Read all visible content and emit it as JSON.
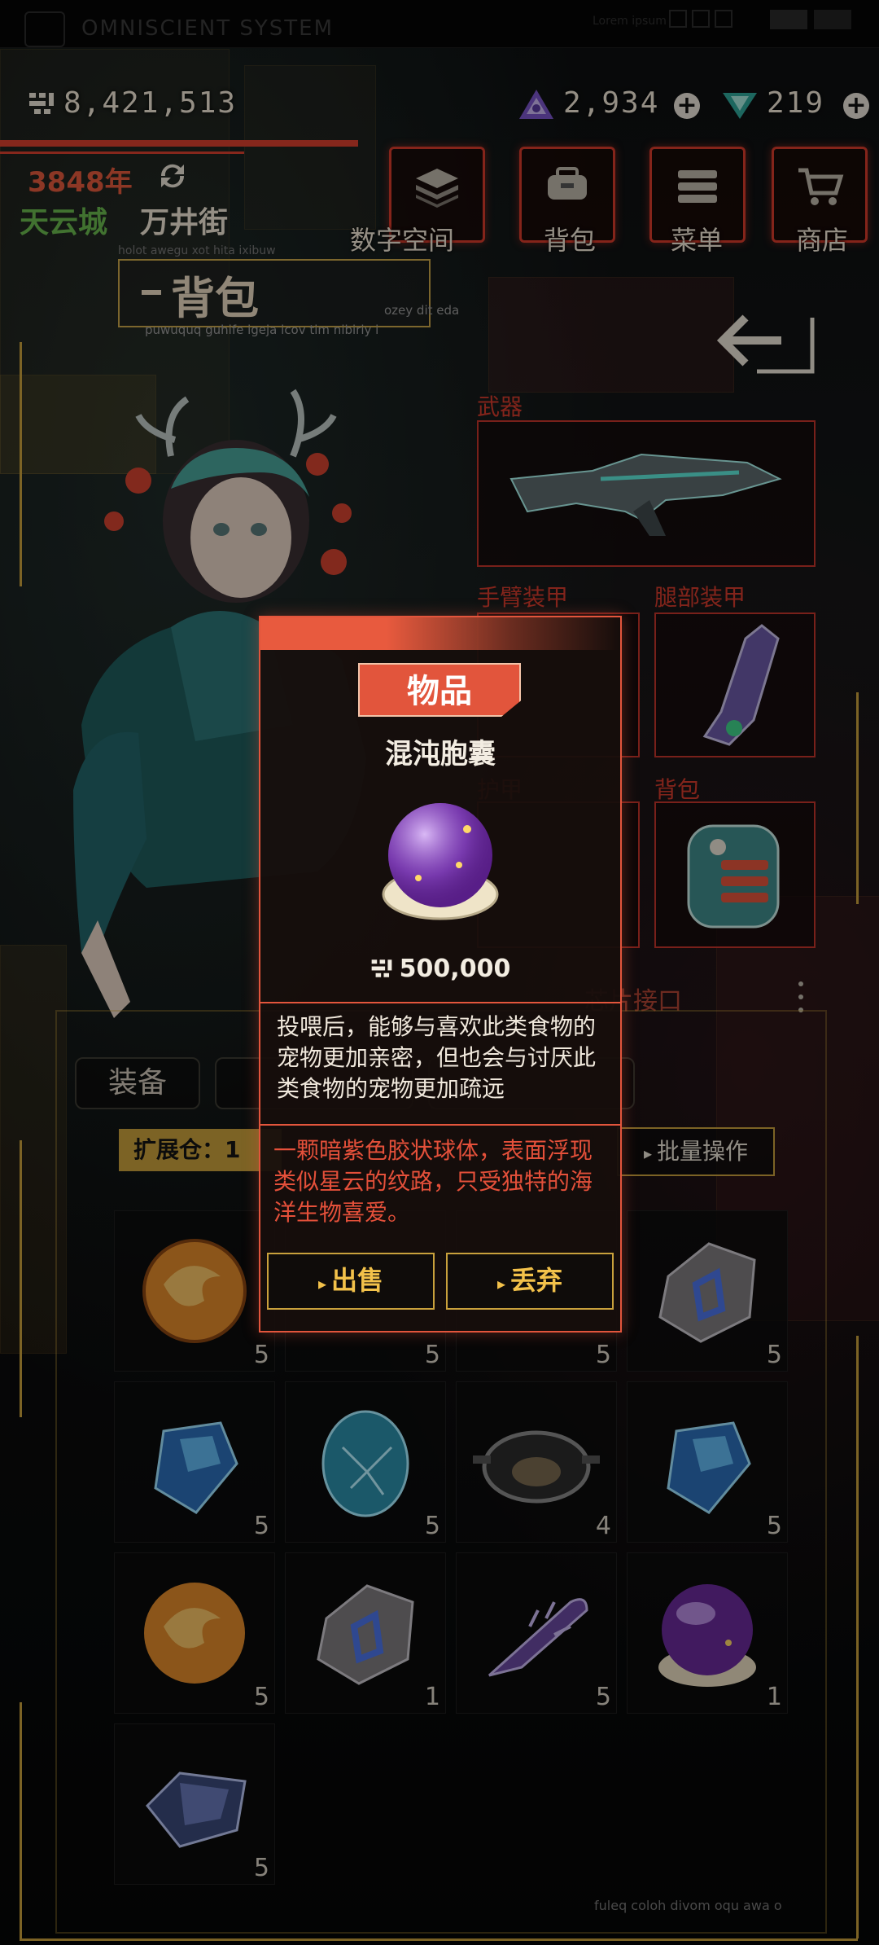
{
  "system": {
    "title": "OMNISCIENT SYSTEM",
    "lorem": "Lorem ipsum"
  },
  "currency": {
    "money": "8,421,513",
    "gems": "2,934",
    "crystals": "219"
  },
  "location": {
    "year": "3848年",
    "city": "天云城",
    "street": "万井街"
  },
  "nav": [
    {
      "label": "数字空间",
      "icon": "layers-icon"
    },
    {
      "label": "背包",
      "icon": "bag-icon"
    },
    {
      "label": "菜单",
      "icon": "menu-icon"
    },
    {
      "label": "商店",
      "icon": "cart-icon"
    }
  ],
  "backpack": {
    "title": "背包",
    "sub1": "holot awegu xot hita ixibuw",
    "sub2": "puwuquq guhife igeja icov tim nibiriy i",
    "sub3": "ozey dit eda"
  },
  "equipment": {
    "weapon_label": "武器",
    "arm_label": "手臂装甲",
    "leg_label": "腿部装甲",
    "chest_label": "护甲",
    "bag_label": "背包",
    "chip_label": "芯片接口"
  },
  "inventory": {
    "tab_equip": "装备",
    "capacity_label": "扩展仓：1",
    "batch_label": "批量操作",
    "items": [
      {
        "icon": "fire-orb-icon",
        "qty": "5"
      },
      {
        "icon": "crystal-egg-icon",
        "qty": "5"
      },
      {
        "icon": "item-icon",
        "qty": "5"
      },
      {
        "icon": "rune-stone-icon",
        "qty": "5"
      },
      {
        "icon": "blue-gem-icon",
        "qty": "5"
      },
      {
        "icon": "crystal-egg-icon",
        "qty": "5"
      },
      {
        "icon": "pan-icon",
        "qty": "4"
      },
      {
        "icon": "blue-gem-icon",
        "qty": "5"
      },
      {
        "icon": "fire-orb-icon",
        "qty": "5"
      },
      {
        "icon": "rune-stone-icon",
        "qty": "1"
      },
      {
        "icon": "shell-icon",
        "qty": "5"
      },
      {
        "icon": "purple-orb-icon",
        "qty": "1"
      },
      {
        "icon": "ore-icon",
        "qty": "5"
      }
    ]
  },
  "popup": {
    "tag": "物品",
    "name": "混沌胞囊",
    "price": "500,000",
    "desc": "投喂后，能够与喜欢此类食物的宠物更加亲密，但也会与讨厌此类食物的宠物更加疏远",
    "lore": "一颗暗紫色胶状球体，表面浮现类似星云的纹路，只受独特的海洋生物喜爱。",
    "sell": "出售",
    "discard": "丢弃"
  },
  "footer": "fuleq coloh divom oqu awa o",
  "colors": {
    "accent_red": "#e2553c",
    "accent_gold": "#c9a13c",
    "city_green": "#69b94e"
  }
}
